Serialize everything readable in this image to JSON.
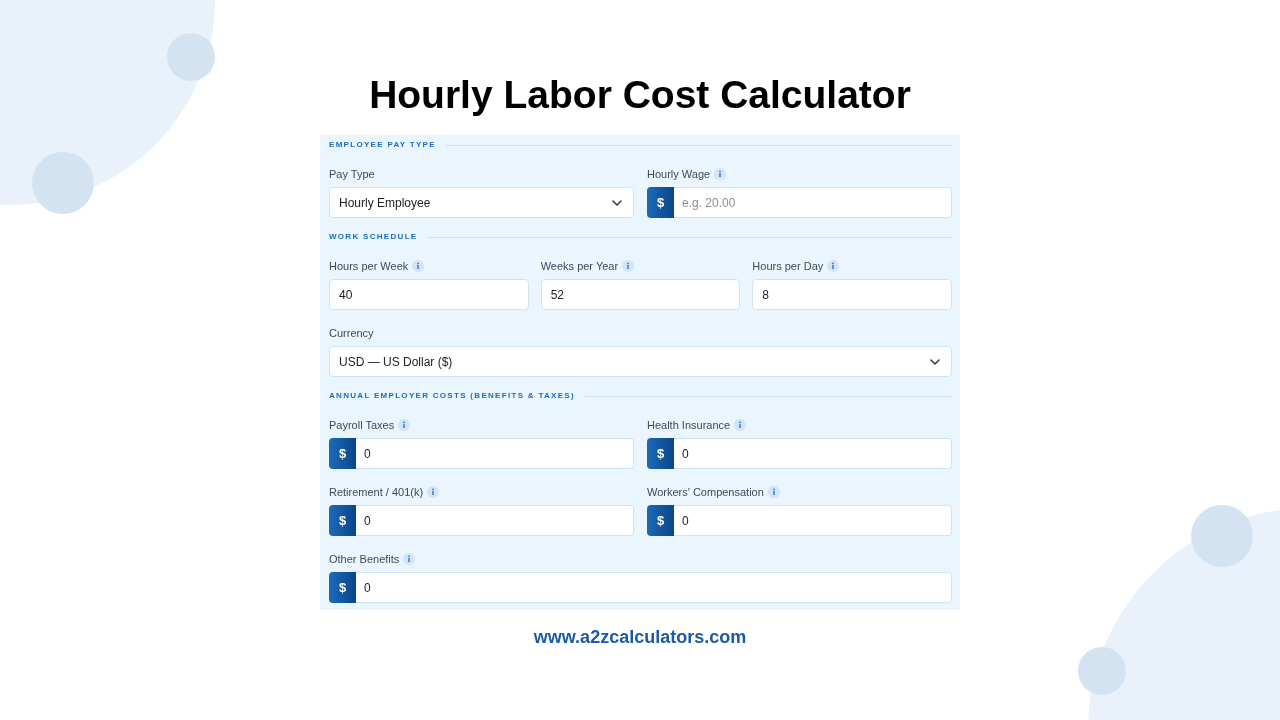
{
  "title": "Hourly Labor Cost Calculator",
  "sections": [
    {
      "heading": "EMPLOYEE PAY TYPE",
      "rows": [
        {
          "fields": [
            {
              "kind": "select",
              "label": "Pay Type",
              "info": false,
              "value": "Hourly Employee"
            },
            {
              "kind": "currency",
              "label": "Hourly Wage",
              "info": true,
              "prefix": "$",
              "placeholder": "e.g. 20.00"
            }
          ]
        }
      ]
    },
    {
      "heading": "WORK SCHEDULE",
      "rows": [
        {
          "fields": [
            {
              "kind": "number",
              "label": "Hours per Week",
              "info": true,
              "value": "40"
            },
            {
              "kind": "number",
              "label": "Weeks per Year",
              "info": true,
              "value": "52"
            },
            {
              "kind": "number",
              "label": "Hours per Day",
              "info": true,
              "value": "8"
            }
          ]
        },
        {
          "fields": [
            {
              "kind": "select",
              "label": "Currency",
              "info": false,
              "value": "USD — US Dollar ($)"
            }
          ]
        }
      ]
    },
    {
      "heading": "ANNUAL EMPLOYER COSTS (BENEFITS & TAXES)",
      "rows": [
        {
          "fields": [
            {
              "kind": "currency",
              "label": "Payroll Taxes",
              "info": true,
              "prefix": "$",
              "value": "0"
            },
            {
              "kind": "currency",
              "label": "Health Insurance",
              "info": true,
              "prefix": "$",
              "value": "0"
            }
          ]
        },
        {
          "fields": [
            {
              "kind": "currency",
              "label": "Retirement / 401(k)",
              "info": true,
              "prefix": "$",
              "value": "0"
            },
            {
              "kind": "currency",
              "label": "Workers' Compensation",
              "info": true,
              "prefix": "$",
              "value": "0"
            }
          ]
        },
        {
          "fields": [
            {
              "kind": "currency",
              "label": "Other Benefits",
              "info": true,
              "prefix": "$",
              "value": "0"
            }
          ]
        }
      ]
    }
  ],
  "footer": {
    "url": "www.a2zcalculators.com"
  }
}
